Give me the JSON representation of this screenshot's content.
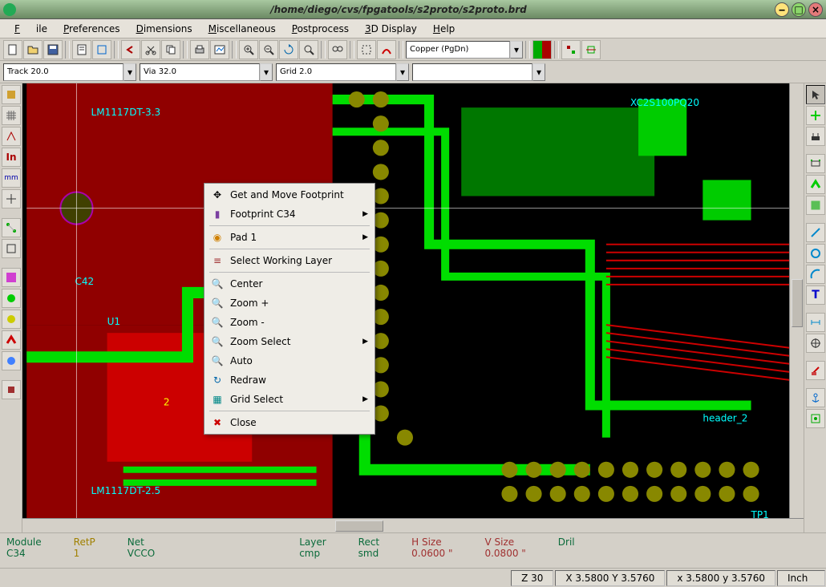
{
  "window": {
    "title": "/home/diego/cvs/fpgatools/s2proto/s2proto.brd"
  },
  "menubar": {
    "file": "File",
    "preferences": "Preferences",
    "dimensions": "Dimensions",
    "miscellaneous": "Miscellaneous",
    "postprocess": "Postprocess",
    "display3d": "3D Display",
    "help": "Help"
  },
  "toolbar": {
    "layer_combo": "Copper   (PgDn)",
    "track_combo": "Track 20.0",
    "via_combo": "Via 32.0",
    "grid_combo": "Grid 2.0",
    "zoom_combo": ""
  },
  "context_menu": {
    "get_move": "Get and Move Footprint",
    "footprint": "Footprint C34",
    "pad": "Pad 1",
    "select_layer": "Select Working Layer",
    "center": "Center",
    "zoom_in": "Zoom +",
    "zoom_out": "Zoom -",
    "zoom_select": "Zoom Select",
    "auto": "Auto",
    "redraw": "Redraw",
    "grid_select": "Grid Select",
    "close": "Close"
  },
  "pcb_labels": {
    "xc": "XC2S100PQ20",
    "lm1": "LM1117DT-3.3",
    "lm2": "LM1117DT-2.5",
    "u1": "U1",
    "c42": "C42",
    "header": "header_2",
    "tp1": "TP1"
  },
  "status1": {
    "module_l": "Module",
    "module_v": "C34",
    "retp_l": "RetP",
    "retp_v": "1",
    "net_l": "Net",
    "net_v": "VCCO",
    "layer_l": "Layer",
    "layer_v": "cmp",
    "rect_l": "Rect",
    "rect_v": "smd",
    "hsize_l": "H Size",
    "hsize_v": "0.0600 \"",
    "vsize_l": "V Size",
    "vsize_v": "0.0800 \"",
    "drill_l": "Dril"
  },
  "status2": {
    "z": "Z 30",
    "xy_abs": "X 3.5800  Y 3.5760",
    "xy_rel": "x 3.5800  y 3.5760",
    "unit": "Inch"
  }
}
